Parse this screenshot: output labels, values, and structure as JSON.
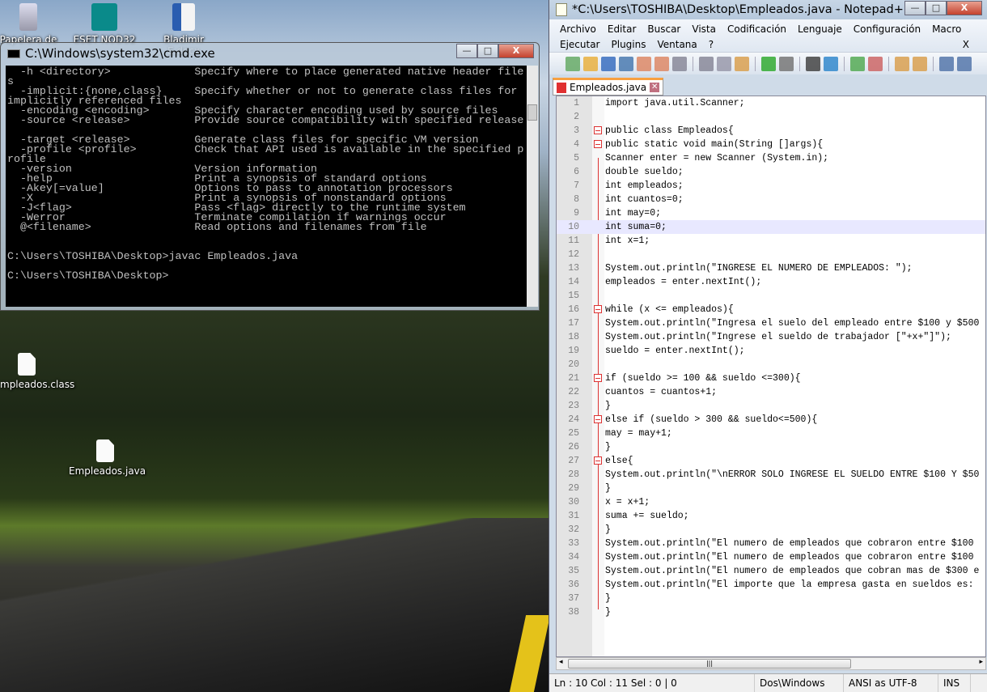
{
  "desktop": {
    "icons": [
      {
        "label": "Papelera de",
        "icon": "recycle-bin-icon"
      },
      {
        "label": "ESET NOD32",
        "icon": "eset-icon"
      },
      {
        "label": "Bladimir E.docx",
        "icon": "word-doc-icon"
      },
      {
        "label": "mpleados.class",
        "icon": "file-icon"
      },
      {
        "label": "Empleados.java",
        "icon": "file-icon"
      }
    ]
  },
  "cmd": {
    "title": "C:\\Windows\\system32\\cmd.exe",
    "lines": [
      "  -h <directory>             Specify where to place generated native header file",
      "s",
      "  -implicit:{none,class}     Specify whether or not to generate class files for",
      "implicitly referenced files",
      "  -encoding <encoding>       Specify character encoding used by source files",
      "  -source <release>          Provide source compatibility with specified release",
      "",
      "  -target <release>          Generate class files for specific VM version",
      "  -profile <profile>         Check that API used is available in the specified p",
      "rofile",
      "  -version                   Version information",
      "  -help                      Print a synopsis of standard options",
      "  -Akey[=value]              Options to pass to annotation processors",
      "  -X                         Print a synopsis of nonstandard options",
      "  -J<flag>                   Pass <flag> directly to the runtime system",
      "  -Werror                    Terminate compilation if warnings occur",
      "  @<filename>                Read options and filenames from file",
      "",
      "",
      "C:\\Users\\TOSHIBA\\Desktop>javac Empleados.java",
      "",
      "C:\\Users\\TOSHIBA\\Desktop>"
    ]
  },
  "npp": {
    "title": "*C:\\Users\\TOSHIBA\\Desktop\\Empleados.java - Notepad++",
    "menu": [
      "Archivo",
      "Editar",
      "Buscar",
      "Vista",
      "Codificación",
      "Lenguaje",
      "Configuración",
      "Macro",
      "Ejecutar",
      "Plugins",
      "Ventana",
      "?"
    ],
    "menu_close": "X",
    "toolbar": [
      "new",
      "open",
      "save",
      "save-all",
      "close",
      "close-all",
      "print",
      "cut",
      "copy",
      "paste",
      "undo",
      "redo",
      "find",
      "replace",
      "zoom-in",
      "zoom-out",
      "sync-v",
      "sync-h",
      "word-wrap",
      "show-all"
    ],
    "tab": {
      "label": "Empleados.java",
      "close": "✕"
    },
    "current_line": 10,
    "fold_lines": [
      3,
      4,
      16,
      21,
      24,
      27
    ],
    "code": [
      "import java.util.Scanner;",
      "",
      "public class Empleados{",
      "public static void main(String []args){",
      "Scanner enter = new Scanner (System.in);",
      "double sueldo;",
      "int empleados;",
      "int cuantos=0;",
      "int may=0;",
      "int suma=0;",
      "int x=1;",
      "",
      "System.out.println(\"INGRESE EL NUMERO DE EMPLEADOS: \");",
      "empleados = enter.nextInt();",
      "",
      "while (x <= empleados){",
      "System.out.println(\"Ingresa el suelo del empleado entre $100 y $500",
      "System.out.println(\"Ingrese el sueldo de trabajador [\"+x+\"]\");",
      "sueldo = enter.nextInt();",
      "",
      "if (sueldo >= 100 && sueldo <=300){",
      "cuantos = cuantos+1;",
      "}",
      "else if (sueldo > 300 && sueldo<=500){",
      "may = may+1;",
      "}",
      "else{",
      "System.out.println(\"\\nERROR SOLO INGRESE EL SUELDO ENTRE $100 Y $50",
      "}",
      "x = x+1;",
      "suma += sueldo;",
      "}",
      "System.out.println(\"El numero de empleados que cobraron entre $100",
      "System.out.println(\"El numero de empleados que cobraron entre $100",
      "System.out.println(\"El numero de empleados que cobran mas de $300 e",
      "System.out.println(\"El importe que la empresa gasta en sueldos es:",
      "}",
      "}"
    ],
    "status": {
      "position": "Ln : 10    Col : 11    Sel : 0 | 0",
      "eol": "Dos\\Windows",
      "encoding": "ANSI as UTF-8",
      "mode": "INS"
    }
  }
}
